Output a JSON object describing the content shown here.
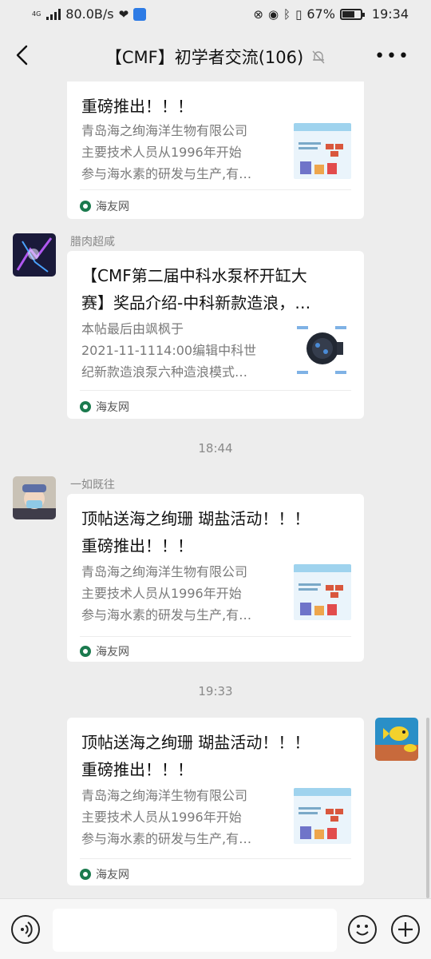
{
  "status": {
    "net_type": "4G",
    "speed": "80.0B/s",
    "battery": "67%",
    "battery_level": 0.67,
    "time": "19:34"
  },
  "header": {
    "title": "【CMF】初学者交流(106)",
    "back_icon": "chevron-left-icon",
    "mute_icon": "bell-muted-icon",
    "more_icon": "more-icon"
  },
  "messages": [
    {
      "title_line2": "重磅推出！！！",
      "desc": [
        "青岛海之绚海洋生物有限公司",
        "主要技术人员从1996年开始",
        "参与海水素的研发与生产,有…"
      ],
      "source": "海友网"
    },
    {
      "sender": "腊肉超咸",
      "title": [
        "【CMF第二届中科水泵杯开缸大",
        "赛】奖品介绍-中科新款造浪，…"
      ],
      "desc": [
        "本帖最后由飒枫于",
        "2021-11-1114:00编辑中科世",
        "纪新款造浪泵六种造浪模式…"
      ],
      "source": "海友网"
    },
    {
      "time": "18:44"
    },
    {
      "sender": "一如既往",
      "title": [
        "顶帖送海之绚珊 瑚盐活动！！！",
        "重磅推出！！！"
      ],
      "desc": [
        "青岛海之绚海洋生物有限公司",
        "主要技术人员从1996年开始",
        "参与海水素的研发与生产,有…"
      ],
      "source": "海友网"
    },
    {
      "time": "19:33"
    },
    {
      "title": [
        "顶帖送海之绚珊 瑚盐活动！！！",
        "重磅推出！！！"
      ],
      "desc": [
        "青岛海之绚海洋生物有限公司",
        "主要技术人员从1996年开始",
        "参与海水素的研发与生产,有…"
      ],
      "source": "海友网"
    }
  ],
  "input_bar": {
    "voice_icon": "voice-icon",
    "emoji_icon": "emoji-icon",
    "plus_icon": "plus-icon"
  },
  "colors": {
    "background": "#ededed",
    "card": "#ffffff",
    "source_logo": "#1b7a4e"
  }
}
